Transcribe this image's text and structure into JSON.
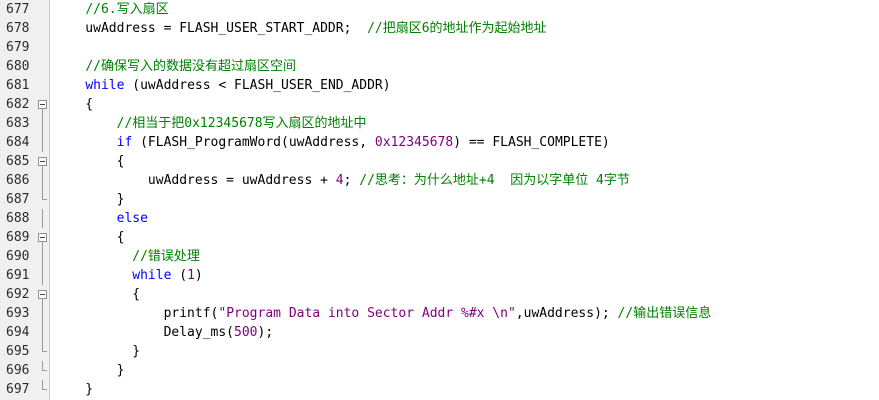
{
  "editor": {
    "lines": [
      {
        "number": "677",
        "fold": "",
        "segments": [
          {
            "t": "    ",
            "c": ""
          },
          {
            "t": "//6.写入扇区",
            "c": "cm"
          }
        ]
      },
      {
        "number": "678",
        "fold": "",
        "segments": [
          {
            "t": "    uwAddress = FLASH_USER_START_ADDR;  ",
            "c": ""
          },
          {
            "t": "//把扇区6的地址作为起始地址",
            "c": "cm"
          }
        ]
      },
      {
        "number": "679",
        "fold": "",
        "segments": [
          {
            "t": "",
            "c": ""
          }
        ]
      },
      {
        "number": "680",
        "fold": "",
        "segments": [
          {
            "t": "    ",
            "c": ""
          },
          {
            "t": "//确保写入的数据没有超过扇区空间",
            "c": "cm"
          }
        ]
      },
      {
        "number": "681",
        "fold": "",
        "segments": [
          {
            "t": "    ",
            "c": ""
          },
          {
            "t": "while",
            "c": "kw"
          },
          {
            "t": " (uwAddress < FLASH_USER_END_ADDR)",
            "c": ""
          }
        ]
      },
      {
        "number": "682",
        "fold": "open",
        "segments": [
          {
            "t": "    {",
            "c": ""
          }
        ]
      },
      {
        "number": "683",
        "fold": "line",
        "segments": [
          {
            "t": "        ",
            "c": ""
          },
          {
            "t": "//相当于把0x12345678写入扇区的地址中",
            "c": "cm"
          }
        ]
      },
      {
        "number": "684",
        "fold": "line",
        "segments": [
          {
            "t": "        ",
            "c": ""
          },
          {
            "t": "if",
            "c": "kw"
          },
          {
            "t": " (FLASH_ProgramWord(uwAddress, ",
            "c": ""
          },
          {
            "t": "0x12345678",
            "c": "num"
          },
          {
            "t": ") == FLASH_COMPLETE)",
            "c": ""
          }
        ]
      },
      {
        "number": "685",
        "fold": "open",
        "segments": [
          {
            "t": "        {",
            "c": ""
          }
        ]
      },
      {
        "number": "686",
        "fold": "line",
        "segments": [
          {
            "t": "            uwAddress = uwAddress + ",
            "c": ""
          },
          {
            "t": "4",
            "c": "num"
          },
          {
            "t": "; ",
            "c": ""
          },
          {
            "t": "//思考：为什么地址+4  因为以字单位 4字节",
            "c": "cm"
          }
        ]
      },
      {
        "number": "687",
        "fold": "end",
        "segments": [
          {
            "t": "        }",
            "c": ""
          }
        ]
      },
      {
        "number": "688",
        "fold": "line",
        "segments": [
          {
            "t": "        ",
            "c": ""
          },
          {
            "t": "else",
            "c": "kw"
          }
        ]
      },
      {
        "number": "689",
        "fold": "open",
        "segments": [
          {
            "t": "        {",
            "c": ""
          }
        ]
      },
      {
        "number": "690",
        "fold": "line",
        "segments": [
          {
            "t": "          ",
            "c": ""
          },
          {
            "t": "//错误处理",
            "c": "cm"
          }
        ]
      },
      {
        "number": "691",
        "fold": "line",
        "segments": [
          {
            "t": "          ",
            "c": ""
          },
          {
            "t": "while",
            "c": "kw"
          },
          {
            "t": " (",
            "c": ""
          },
          {
            "t": "1",
            "c": "num"
          },
          {
            "t": ")",
            "c": ""
          }
        ]
      },
      {
        "number": "692",
        "fold": "open",
        "segments": [
          {
            "t": "          {",
            "c": ""
          }
        ]
      },
      {
        "number": "693",
        "fold": "line",
        "segments": [
          {
            "t": "              printf(",
            "c": ""
          },
          {
            "t": "\"Program Data into Sector Addr %#x \\n\"",
            "c": "str"
          },
          {
            "t": ",uwAddress); ",
            "c": ""
          },
          {
            "t": "//输出错误信息",
            "c": "cm"
          }
        ]
      },
      {
        "number": "694",
        "fold": "line",
        "segments": [
          {
            "t": "              Delay_ms(",
            "c": ""
          },
          {
            "t": "500",
            "c": "num"
          },
          {
            "t": ");",
            "c": ""
          }
        ]
      },
      {
        "number": "695",
        "fold": "end",
        "segments": [
          {
            "t": "          }",
            "c": ""
          }
        ]
      },
      {
        "number": "696",
        "fold": "end",
        "segments": [
          {
            "t": "        }",
            "c": ""
          }
        ]
      },
      {
        "number": "697",
        "fold": "end",
        "segments": [
          {
            "t": "    }",
            "c": ""
          }
        ]
      }
    ]
  }
}
